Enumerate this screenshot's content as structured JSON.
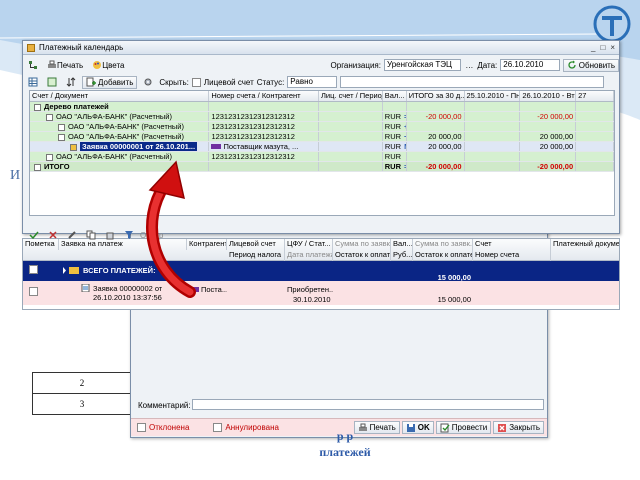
{
  "slide": {
    "bg_letter": "И",
    "bg_table_rows": [
      "2",
      "3"
    ],
    "caption_line1": "р р",
    "caption_line2": "платежей"
  },
  "window": {
    "title": "Платежный календарь",
    "controls": [
      "_",
      "□",
      "×"
    ],
    "toolbar1": {
      "print": "Печать",
      "colors": "Цвета"
    },
    "org_label": "Организация:",
    "org_value": "Уренгойская ТЭЦ",
    "date_label": "Дата:",
    "date_value": "26.10.2010",
    "refresh": "Обновить",
    "toolbar2": {
      "add": "Добавить",
      "hide_label": "Скрыть:",
      "personal_acc": "Лицевой счет",
      "status_label": "Статус:",
      "status_value": "Равно"
    }
  },
  "grid1": {
    "headers": [
      "Счет / Документ",
      "Номер счета / Контрагент",
      "Лиц. счет / Период на...",
      "Вал...",
      "ИТОГО за 30 д...",
      "25.10.2010 - Пн",
      "26.10.2010 - Вт",
      "27"
    ],
    "rows": [
      {
        "cls": "green",
        "indent": 0,
        "doc": "Дерево платежей",
        "bold": true,
        "acct": "",
        "lic": "",
        "cur": "",
        "total": "",
        "d1": "",
        "d2": "",
        "sign": ""
      },
      {
        "cls": "green",
        "indent": 1,
        "doc": "ОАО \"АЛЬФА-БАНК\" (Расчетный)",
        "bold": false,
        "acct": "12312312312312312312",
        "lic": "",
        "cur": "RUR",
        "sign": "=",
        "total": "-20 000,00",
        "d1": "",
        "d2": "-20 000,00"
      },
      {
        "cls": "green",
        "indent": 2,
        "doc": "ОАО \"АЛЬФА-БАНК\" (Расчетный)",
        "bold": false,
        "acct": "12312312312312312312",
        "lic": "",
        "cur": "RUR",
        "sign": "+",
        "total": "",
        "d1": "",
        "d2": ""
      },
      {
        "cls": "green",
        "indent": 2,
        "doc": "ОАО \"АЛЬФА-БАНК\" (Расчетный)",
        "bold": false,
        "acct": "12312312312312312312",
        "lic": "",
        "cur": "RUR",
        "sign": "−",
        "total": "20 000,00",
        "d1": "",
        "d2": "20 000,00"
      },
      {
        "cls": "sel",
        "indent": 3,
        "doc": "Заявка 00000001 от 26.10.201...",
        "bold": true,
        "acct": "Поставщик мазута, ...",
        "lic": "",
        "cur": "RUR",
        "sign": "М...",
        "total": "20 000,00",
        "d1": "",
        "d2": "20 000,00"
      },
      {
        "cls": "green",
        "indent": 1,
        "doc": "ОАО \"АЛЬФА-БАНК\" (Расчетный)",
        "bold": false,
        "acct": "12312312312312312312",
        "lic": "",
        "cur": "RUR",
        "sign": "",
        "total": "",
        "d1": "",
        "d2": ""
      },
      {
        "cls": "total",
        "indent": 0,
        "doc": "ИТОГО",
        "bold": true,
        "acct": "",
        "lic": "",
        "cur": "RUR",
        "sign": "=",
        "total": "-20 000,00",
        "d1": "",
        "d2": "-20 000,00"
      }
    ]
  },
  "grid2": {
    "toolbar_label": "Отбор",
    "headers_top": [
      "Пометка",
      "Заявка на платеж",
      "Контрагент",
      "Лицевой счет",
      "ЦФУ / Стат...",
      "Сумма по заявке",
      "Вал...",
      "Сумма по заявк...",
      "Счет",
      "Платежный докуме..."
    ],
    "headers_bottom": [
      "Период налога",
      "Дата платежа",
      "Остаток к оплате",
      "Руб...",
      "Остаток к оплате",
      "Номер счета"
    ],
    "total_row": {
      "label": "ВСЕГО ПЛАТЕЖЕЙ:",
      "sum": "15 000,00"
    },
    "item_row": {
      "doc_line1": "Заявка 00000002 от",
      "doc_line2": "26.10.2010 13:37:56",
      "contractor": "Поста...",
      "cfu": "Приобретен...",
      "date": "30.10.2010",
      "sum": "15 000,00"
    }
  },
  "subform": {
    "comment_label": "Комментарий:",
    "rejected": "Отклонена",
    "cancelled": "Аннулирована",
    "print": "Печать",
    "ok": "OK",
    "post": "Провести",
    "close": "Закрыть"
  }
}
